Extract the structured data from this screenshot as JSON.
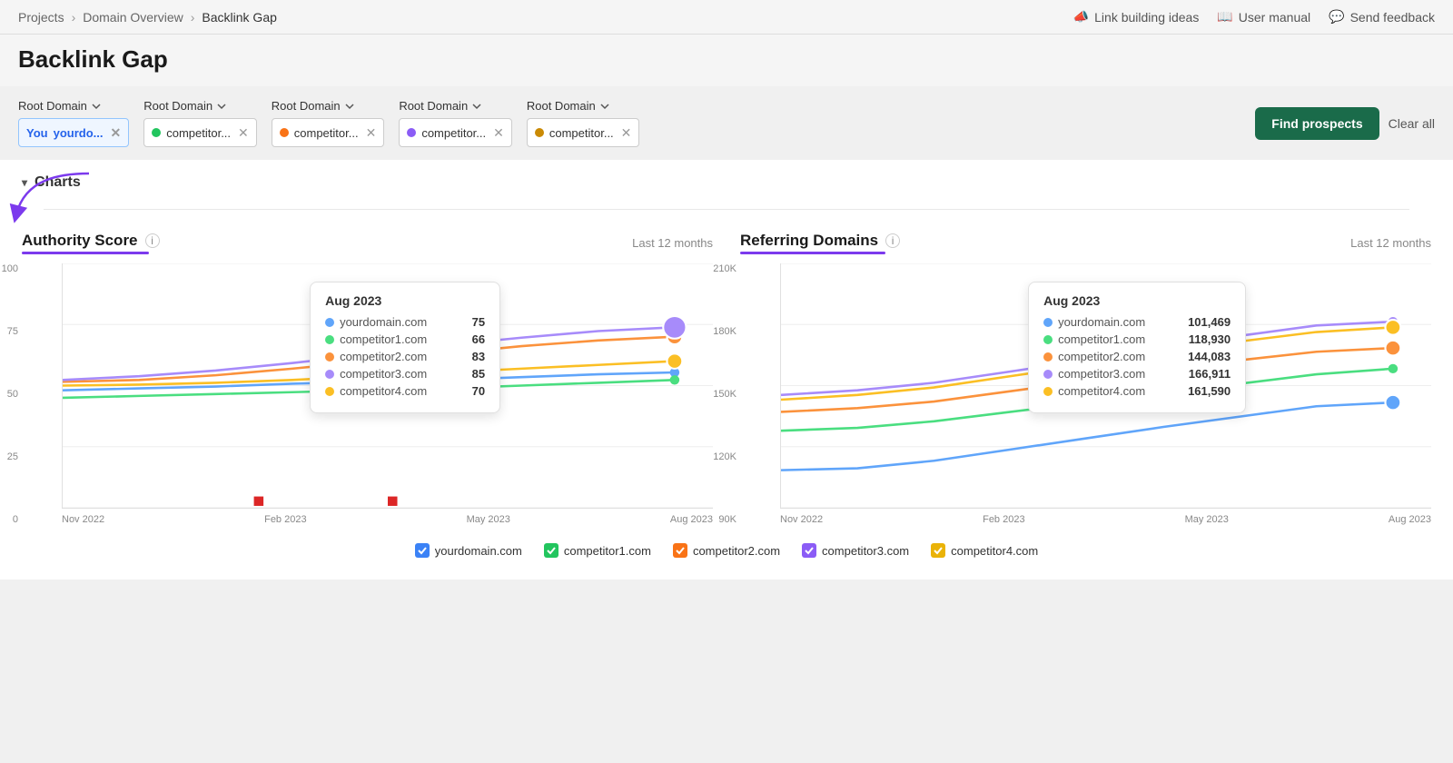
{
  "breadcrumb": {
    "items": [
      "Projects",
      "Domain Overview",
      "Backlink Gap"
    ]
  },
  "top_actions": [
    {
      "icon": "megaphone-icon",
      "label": "Link building ideas"
    },
    {
      "icon": "book-icon",
      "label": "User manual"
    },
    {
      "icon": "chat-icon",
      "label": "Send feedback"
    }
  ],
  "page_title": "Backlink Gap",
  "domain_groups": [
    {
      "label": "Root Domain",
      "chip_type": "you",
      "chip_label": "You",
      "chip_value": "yourdо...",
      "color": "#2563eb"
    },
    {
      "label": "Root Domain",
      "chip_type": "competitor",
      "chip_value": "competitor...",
      "color": "#22c55e"
    },
    {
      "label": "Root Domain",
      "chip_type": "competitor",
      "chip_value": "competitor...",
      "color": "#f97316"
    },
    {
      "label": "Root Domain",
      "chip_type": "competitor",
      "chip_value": "competitor...",
      "color": "#8b5cf6"
    },
    {
      "label": "Root Domain",
      "chip_type": "competitor",
      "chip_value": "competitor...",
      "color": "#ca8a04"
    }
  ],
  "buttons": {
    "find_prospects": "Find prospects",
    "clear_all": "Clear all"
  },
  "charts_section": {
    "header": "Charts",
    "chart1": {
      "title": "Authority Score",
      "period": "Last 12 months",
      "y_axis": [
        "100",
        "75",
        "50",
        "25",
        "0"
      ],
      "x_axis": [
        "Nov 2022",
        "Feb 2023",
        "May 2023",
        "Aug 2023"
      ],
      "tooltip": {
        "date": "Aug 2023",
        "rows": [
          {
            "domain": "yourdomain.com",
            "value": "75",
            "color": "#60a5fa"
          },
          {
            "domain": "competitor1.com",
            "value": "66",
            "color": "#4ade80"
          },
          {
            "domain": "competitor2.com",
            "value": "83",
            "color": "#fb923c"
          },
          {
            "domain": "competitor3.com",
            "value": "85",
            "color": "#a78bfa"
          },
          {
            "domain": "competitor4.com",
            "value": "70",
            "color": "#fbbf24"
          }
        ]
      }
    },
    "chart2": {
      "title": "Referring Domains",
      "period": "Last 12 months",
      "y_axis": [
        "210K",
        "180K",
        "150K",
        "120K",
        "90K"
      ],
      "x_axis": [
        "Nov 2022",
        "Feb 2023",
        "May 2023",
        "Aug 2023"
      ],
      "tooltip": {
        "date": "Aug 2023",
        "rows": [
          {
            "domain": "yourdomain.com",
            "value": "101,469",
            "color": "#60a5fa"
          },
          {
            "domain": "competitor1.com",
            "value": "118,930",
            "color": "#4ade80"
          },
          {
            "domain": "competitor2.com",
            "value": "144,083",
            "color": "#fb923c"
          },
          {
            "domain": "competitor3.com",
            "value": "166,911",
            "color": "#a78bfa"
          },
          {
            "domain": "competitor4.com",
            "value": "161,590",
            "color": "#fbbf24"
          }
        ]
      }
    },
    "legend": [
      {
        "label": "yourdomain.com",
        "color": "#3b82f6"
      },
      {
        "label": "competitor1.com",
        "color": "#22c55e"
      },
      {
        "label": "competitor2.com",
        "color": "#f97316"
      },
      {
        "label": "competitor3.com",
        "color": "#8b5cf6"
      },
      {
        "label": "competitor4.com",
        "color": "#eab308"
      }
    ]
  }
}
